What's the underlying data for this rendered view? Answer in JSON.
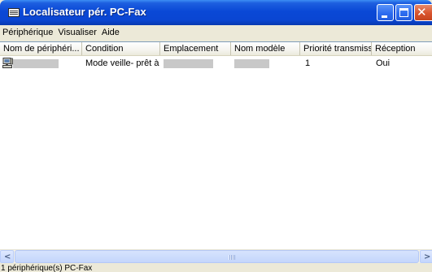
{
  "window": {
    "title": "Localisateur pér. PC-Fax"
  },
  "menu": {
    "items": [
      "Périphérique",
      "Visualiser",
      "Aide"
    ]
  },
  "list": {
    "columns": [
      "Nom de périphéri...",
      "Condition",
      "Emplacement",
      "Nom modèle",
      "Priorité transmission",
      "Réception"
    ],
    "rows": [
      {
        "icon": "pc-icon",
        "name": "",
        "condition": "Mode veille- prêt à f...",
        "emplacement": "",
        "nom_modele": "",
        "priorite": "1",
        "reception": "Oui"
      }
    ]
  },
  "status": {
    "text": "1 périphérique(s) PC-Fax"
  },
  "colors": {
    "titlebar": "#0a48d6",
    "window_bg": "#ece9d8",
    "close_button": "#d8532d"
  }
}
